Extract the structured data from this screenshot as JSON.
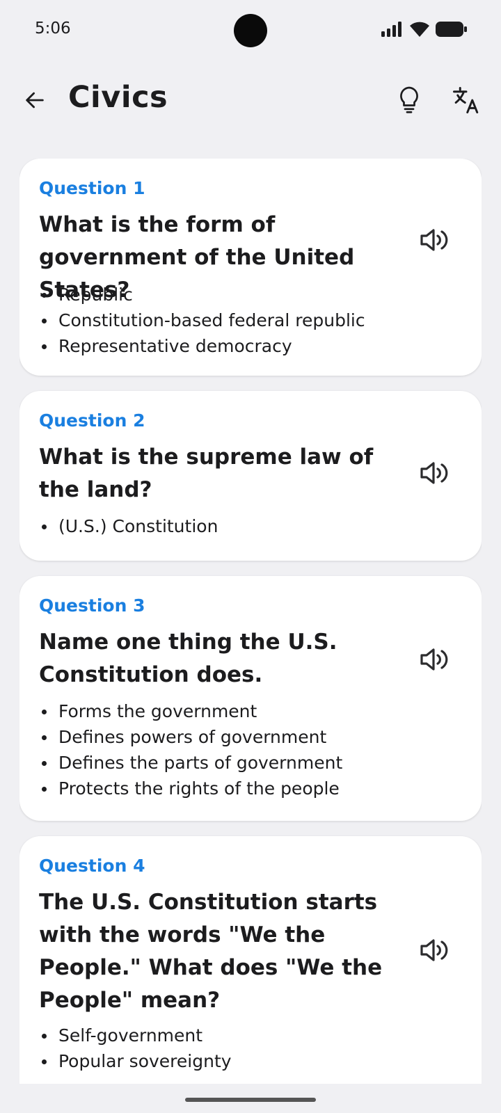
{
  "status_bar": {
    "time": "5:06"
  },
  "app_bar": {
    "title": "Civics",
    "icons": {
      "back": "arrow-left-icon",
      "hint": "lightbulb-icon",
      "translate": "translate-icon"
    }
  },
  "colors": {
    "accent": "#1a7fe0",
    "background": "#f0f0f3",
    "card": "#ffffff",
    "text": "#1c1c1e"
  },
  "questions": [
    {
      "label": "Question 1",
      "text": "What is the form of government of the United States?",
      "answers": [
        "Republic",
        "Constitution-based federal republic",
        "Representative democracy"
      ]
    },
    {
      "label": "Question 2",
      "text": "What is the supreme law of the land?",
      "answers": [
        "(U.S.) Constitution"
      ]
    },
    {
      "label": "Question 3",
      "text": "Name one thing the U.S. Constitution does.",
      "answers": [
        "Forms the government",
        "Defines powers of government",
        "Defines the parts of government",
        "Protects the rights of the people"
      ]
    },
    {
      "label": "Question 4",
      "text": "The U.S. Constitution starts with the words \"We the People.\" What does \"We the People\" mean?",
      "answers": [
        "Self-government",
        "Popular sovereignty"
      ]
    }
  ]
}
